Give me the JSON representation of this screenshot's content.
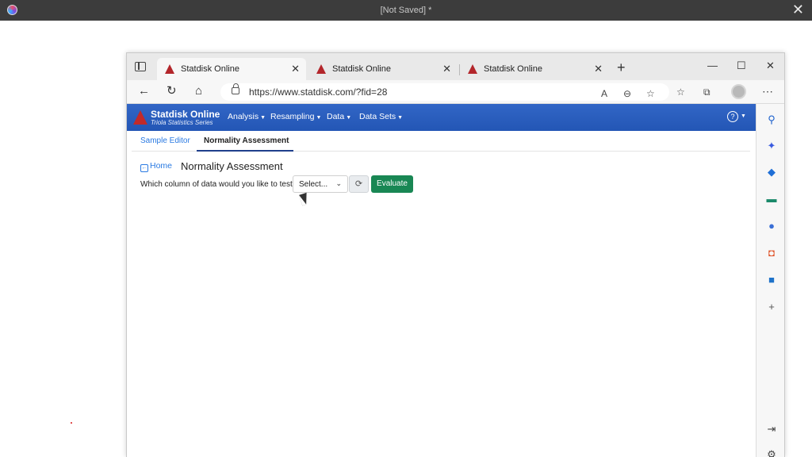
{
  "outer": {
    "doc_title": "[Not Saved]  *",
    "close_glyph": "✕"
  },
  "browser": {
    "tabs": [
      {
        "label": "Statdisk Online",
        "close": "✕"
      },
      {
        "label": "Statdisk Online",
        "close": "✕"
      },
      {
        "label": "Statdisk Online",
        "close": "✕"
      }
    ],
    "new_tab_glyph": "+",
    "window_controls": {
      "minimize": "—",
      "maximize": "☐",
      "close": "✕"
    },
    "url": "https://www.statdisk.com/?fid=28"
  },
  "site": {
    "brand_name": "Statdisk Online",
    "brand_sub": "Triola Statistics Series",
    "menu": [
      {
        "label": "Analysis"
      },
      {
        "label": "Resampling"
      },
      {
        "label": "Data"
      },
      {
        "label": "Data Sets"
      }
    ],
    "caret": "▼",
    "help_glyph": "?"
  },
  "subtabs": {
    "sample_editor": "Sample Editor",
    "normality": "Normality Assessment"
  },
  "content": {
    "home_link": "Home",
    "home_glyph": "←",
    "title": "Normality Assessment",
    "question": "Which column of data would you like to test?",
    "select_value": "Select...",
    "select_chevron": "⌄",
    "refresh_glyph": "⟳",
    "evaluate_label": "Evaluate"
  },
  "colors": {
    "navbar": "#2356b5",
    "evaluate": "#198754",
    "link": "#2a7ae2",
    "logo": "#b3262b"
  }
}
